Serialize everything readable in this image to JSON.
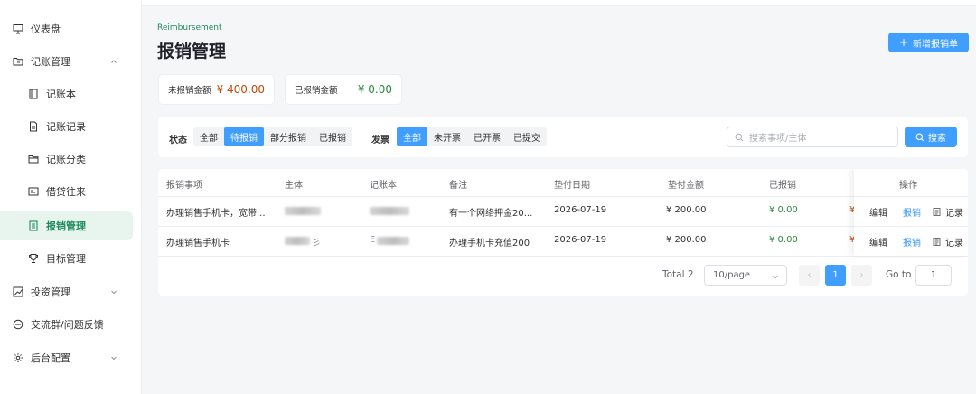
{
  "sidebar": {
    "items": [
      {
        "label": "仪表盘",
        "icon": "presentation-icon"
      },
      {
        "label": "记账管理",
        "icon": "folder-icon",
        "expanded": true
      },
      {
        "label": "记账本",
        "icon": "notebook-icon"
      },
      {
        "label": "记账记录",
        "icon": "document-icon"
      },
      {
        "label": "记账分类",
        "icon": "category-icon"
      },
      {
        "label": "借贷往来",
        "icon": "card-icon"
      },
      {
        "label": "报销管理",
        "icon": "receipt-icon",
        "active": true
      },
      {
        "label": "目标管理",
        "icon": "trophy-icon"
      },
      {
        "label": "投资管理",
        "icon": "chart-icon",
        "expanded": false
      },
      {
        "label": "交流群/问题反馈",
        "icon": "chat-icon"
      },
      {
        "label": "后台配置",
        "icon": "gear-icon",
        "expanded": false
      }
    ]
  },
  "header": {
    "eyebrow": "Reimbursement",
    "title": "报销管理",
    "new_button": "新增报销单"
  },
  "stats": {
    "unreimbursed_label": "未报销金额",
    "unreimbursed_value": "¥ 400.00",
    "reimbursed_label": "已报销金额",
    "reimbursed_value": "¥ 0.00"
  },
  "filters": {
    "status_label": "状态",
    "status_options": [
      "全部",
      "待报销",
      "部分报销",
      "已报销"
    ],
    "status_selected": "待报销",
    "invoice_label": "发票",
    "invoice_options": [
      "全部",
      "未开票",
      "已开票",
      "已提交"
    ],
    "invoice_selected": "全部",
    "search_placeholder": "搜索事项/主体",
    "search_button": "搜索"
  },
  "table": {
    "columns": [
      "报销事项",
      "主体",
      "记账本",
      "备注",
      "垫付日期",
      "垫付金额",
      "已报销",
      "操作"
    ],
    "rows": [
      {
        "item": "办理销售手机卡，宽带...",
        "subject": "",
        "book": "",
        "note": "有一个网络押金20...",
        "date": "2026-07-19",
        "amount": "¥ 200.00",
        "reimbursed": "¥ 0.00",
        "pending_prefix": "¥"
      },
      {
        "item": "办理销售手机卡",
        "subject": "彡",
        "book": "E",
        "note": "办理手机卡充值200",
        "date": "2026-07-19",
        "amount": "¥ 200.00",
        "reimbursed": "¥ 0.00",
        "pending_prefix": "¥"
      }
    ],
    "actions": {
      "edit": "编辑",
      "report": "报销",
      "record": "记录"
    }
  },
  "pagination": {
    "total": "Total 2",
    "page_size": "10/page",
    "prev": "‹",
    "current": "1",
    "next": "›",
    "goto_label": "Go to",
    "goto_value": "1"
  },
  "colors": {
    "primary": "#409eff",
    "accent_green": "#1f8a5b",
    "amount_red": "#c0480b",
    "amount_green": "#2e8b3d"
  }
}
